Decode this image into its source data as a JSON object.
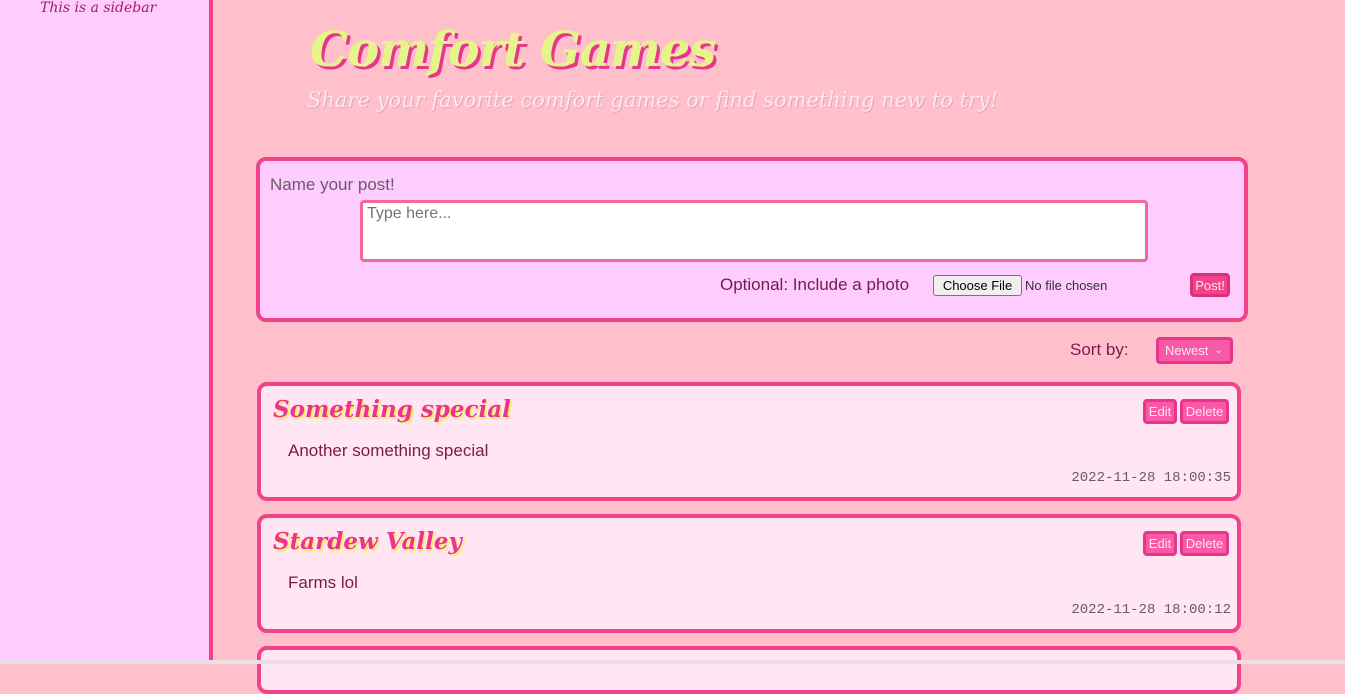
{
  "sidebar": {
    "text": "This is a sidebar"
  },
  "header": {
    "title": "Comfort Games",
    "subtitle": "Share your favorite comfort games or find something new to try!"
  },
  "compose": {
    "label": "Name your post!",
    "placeholder": "Type here...",
    "photo_label": "Optional: Include a photo",
    "file_button": "Choose File",
    "file_status": "No file chosen",
    "post_button": "Post!"
  },
  "sort": {
    "label": "Sort by:",
    "selected": "Newest"
  },
  "posts": [
    {
      "title": "Something special",
      "body": "Another something special",
      "timestamp": "2022-11-28 18:00:35",
      "edit": "Edit",
      "delete": "Delete"
    },
    {
      "title": "Stardew Valley",
      "body": "Farms lol",
      "timestamp": "2022-11-28 18:00:12",
      "edit": "Edit",
      "delete": "Delete"
    }
  ],
  "colors": {
    "background": "#ffc0cb",
    "sidebar": "#ffccff",
    "accent": "#f0448a",
    "title_fill": "#e6f58a"
  }
}
